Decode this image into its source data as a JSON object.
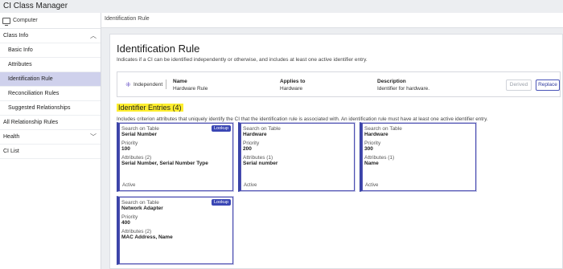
{
  "app": {
    "title": "CI Class Manager"
  },
  "sidebar": {
    "header": "Computer",
    "items": [
      {
        "label": "Class Info",
        "type": "section",
        "chevron": "up"
      },
      {
        "label": "Basic Info",
        "type": "sub"
      },
      {
        "label": "Attributes",
        "type": "sub"
      },
      {
        "label": "Identification Rule",
        "type": "sub",
        "active": true
      },
      {
        "label": "Reconciliation Rules",
        "type": "sub"
      },
      {
        "label": "Suggested Relationships",
        "type": "sub"
      },
      {
        "label": "All Relationship Rules",
        "type": "section"
      },
      {
        "label": "Health",
        "type": "section",
        "chevron": "down"
      },
      {
        "label": "CI List",
        "type": "section"
      }
    ]
  },
  "breadcrumb": "Identification Rule",
  "page": {
    "title": "Identification Rule",
    "description": "Indicates if a CI can be identified independently or otherwise, and includes at least one active identifier entry."
  },
  "rule": {
    "type_label": "Independent",
    "name_header": "Name",
    "name_value": "Hardware Rule",
    "applies_header": "Applies to",
    "applies_value": "Hardware",
    "description_header": "Description",
    "description_value": "Identifier for hardware.",
    "derived_label": "Derived",
    "replace_label": "Replace"
  },
  "entries": {
    "title": "Identifier Entries (4)",
    "description": "Includes criterion attributes that uniquely identify the CI that the identification rule is associated with. An identification rule must have at least one active identifier entry.",
    "table_label": "Search on Table",
    "priority_label": "Priority",
    "status": "Active",
    "cards": [
      {
        "table": "Serial Number",
        "priority": "100",
        "attributes_label": "Attributes (2)",
        "attributes": "Serial Number, Serial Number Type",
        "lookup": "Lookup"
      },
      {
        "table": "Hardware",
        "priority": "200",
        "attributes_label": "Attributes (1)",
        "attributes": "Serial number"
      },
      {
        "table": "Hardware",
        "priority": "300",
        "attributes_label": "Attributes (1)",
        "attributes": "Name"
      },
      {
        "table": "Network Adapter",
        "priority": "400",
        "attributes_label": "Attributes (2)",
        "attributes": "MAC Address, Name",
        "lookup": "Lookup"
      }
    ]
  },
  "colors": {
    "accent": "#3b44a8",
    "highlight": "#ffef2e",
    "active_nav": "#cfd1ec"
  }
}
